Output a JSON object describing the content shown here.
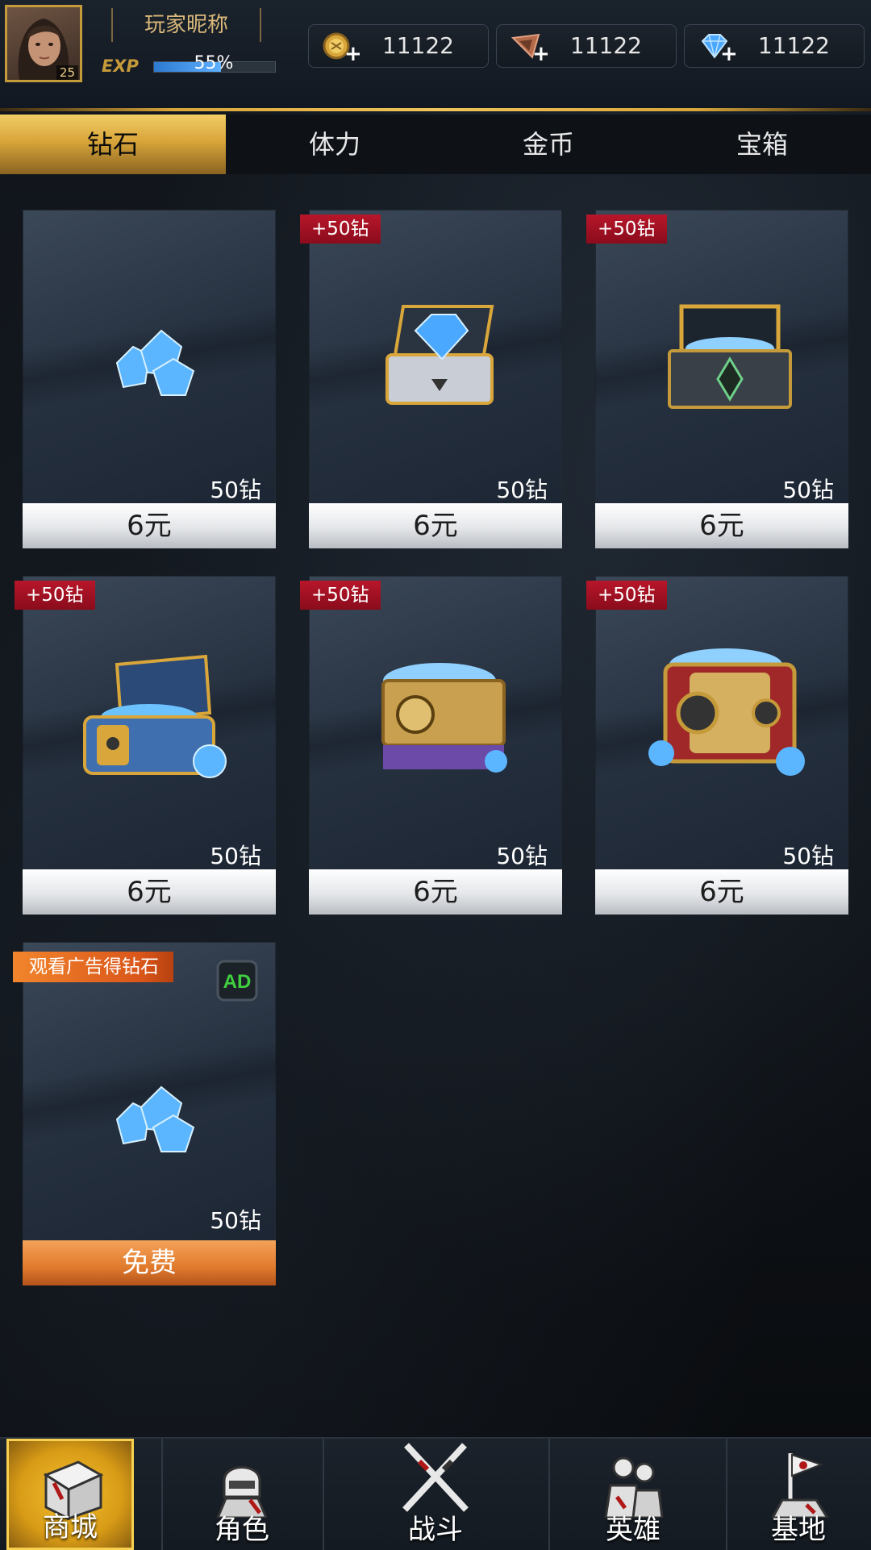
{
  "player": {
    "nickname": "玩家昵称",
    "level": "25",
    "exp_label": "EXP",
    "exp_percent_text": "55%",
    "exp_fraction": 0.55
  },
  "currencies": [
    {
      "icon": "gold-coin-icon",
      "value": "11122"
    },
    {
      "icon": "stamina-ticket-icon",
      "value": "11122"
    },
    {
      "icon": "diamond-icon",
      "value": "11122"
    }
  ],
  "tabs": [
    {
      "label": "钻石",
      "active": true
    },
    {
      "label": "体力",
      "active": false
    },
    {
      "label": "金币",
      "active": false
    },
    {
      "label": "宝箱",
      "active": false
    }
  ],
  "products": [
    {
      "bonus": "",
      "amount": "50钻",
      "price": "6元",
      "art": "diamond-pile-icon"
    },
    {
      "bonus": "+50钻",
      "amount": "50钻",
      "price": "6元",
      "art": "silver-chest-icon"
    },
    {
      "bonus": "+50钻",
      "amount": "50钻",
      "price": "6元",
      "art": "dark-chest-icon"
    },
    {
      "bonus": "+50钻",
      "amount": "50钻",
      "price": "6元",
      "art": "blue-chest-icon"
    },
    {
      "bonus": "+50钻",
      "amount": "50钻",
      "price": "6元",
      "art": "gold-purple-chest-icon"
    },
    {
      "bonus": "+50钻",
      "amount": "50钻",
      "price": "6元",
      "art": "red-chest-icon"
    }
  ],
  "ad_offer": {
    "tag": "观看广告得钻石",
    "ad_badge": "AD",
    "amount": "50钻",
    "price": "免费"
  },
  "bottom_nav": [
    {
      "label": "商城",
      "icon": "shop-crate-icon",
      "active": true
    },
    {
      "label": "角色",
      "icon": "character-helmet-icon",
      "active": false
    },
    {
      "label": "战斗",
      "icon": "crossed-rifles-icon",
      "active": false
    },
    {
      "label": "英雄",
      "icon": "heroes-icon",
      "active": false
    },
    {
      "label": "基地",
      "icon": "base-flag-icon",
      "active": false
    }
  ],
  "colors": {
    "accent_gold": "#d8a53a",
    "bonus_red": "#a5101f",
    "free_orange": "#e07a2c"
  }
}
